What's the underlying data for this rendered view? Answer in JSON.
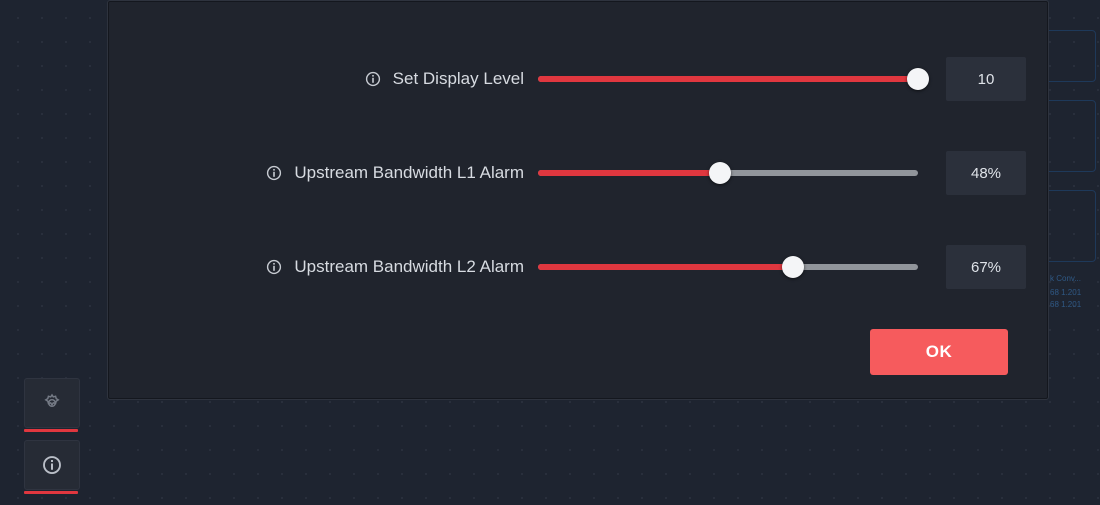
{
  "sliders": [
    {
      "label": "Set Display Level",
      "percent": 100,
      "value": "10"
    },
    {
      "label": "Upstream Bandwidth L1 Alarm",
      "percent": 48,
      "value": "48%"
    },
    {
      "label": "Upstream Bandwidth L2 Alarm",
      "percent": 67,
      "value": "67%"
    }
  ],
  "ok_label": "OK",
  "bg_text": {
    "a": "k Conv...",
    "b": "68 1.201",
    "c": "68 1.201"
  }
}
